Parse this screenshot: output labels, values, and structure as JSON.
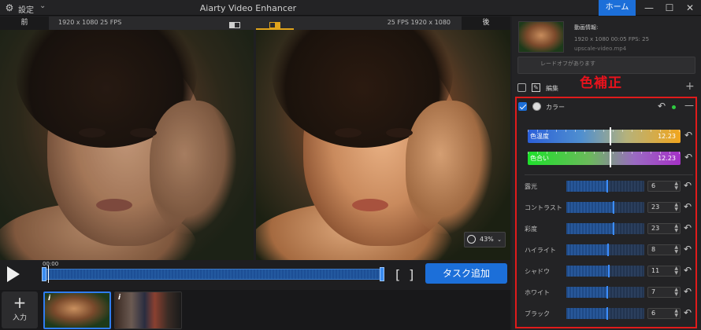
{
  "titlebar": {
    "settings_label": "設定",
    "app_title": "Aiarty Video Enhancer",
    "home_label": "ホーム"
  },
  "compare": {
    "before_label": "前",
    "after_label": "後",
    "left_info": "1920 x 1080  25 FPS",
    "right_info": "25 FPS  1920 x 1080"
  },
  "zoom": {
    "value": "43%"
  },
  "playback": {
    "time": "00:00",
    "add_task_label": "タスク追加",
    "trim_start": "[",
    "trim_end": "]"
  },
  "strip": {
    "input_label": "入力",
    "input_plus": "+",
    "info_badge": "i"
  },
  "video_info": {
    "title": "動画情報:",
    "meta": "1920 x 1080  00:05    FPS: 25",
    "filename": "upscale-video.mp4",
    "tradeoff_text": "レードオフがあります"
  },
  "edit": {
    "label": "編集",
    "add": "+"
  },
  "callout": "色補正",
  "color": {
    "label": "カラー",
    "temperature": {
      "name": "色温度",
      "value": "12.23",
      "level": 0.54
    },
    "tint": {
      "name": "色合い",
      "value": "12.23",
      "level": 0.54
    }
  },
  "adjustments": [
    {
      "name": "露光",
      "value": "6",
      "level": 0.53
    },
    {
      "name": "コントラスト",
      "value": "23",
      "level": 0.61
    },
    {
      "name": "彩度",
      "value": "23",
      "level": 0.61
    },
    {
      "name": "ハイライト",
      "value": "8",
      "level": 0.54
    },
    {
      "name": "シャドウ",
      "value": "11",
      "level": 0.55
    },
    {
      "name": "ホワイト",
      "value": "7",
      "level": 0.53
    },
    {
      "name": "ブラック",
      "value": "6",
      "level": 0.53
    }
  ],
  "colors": {
    "accent": "#1c6fd9",
    "highlight": "#e01b1b",
    "compare_active": "#e0a41c"
  }
}
